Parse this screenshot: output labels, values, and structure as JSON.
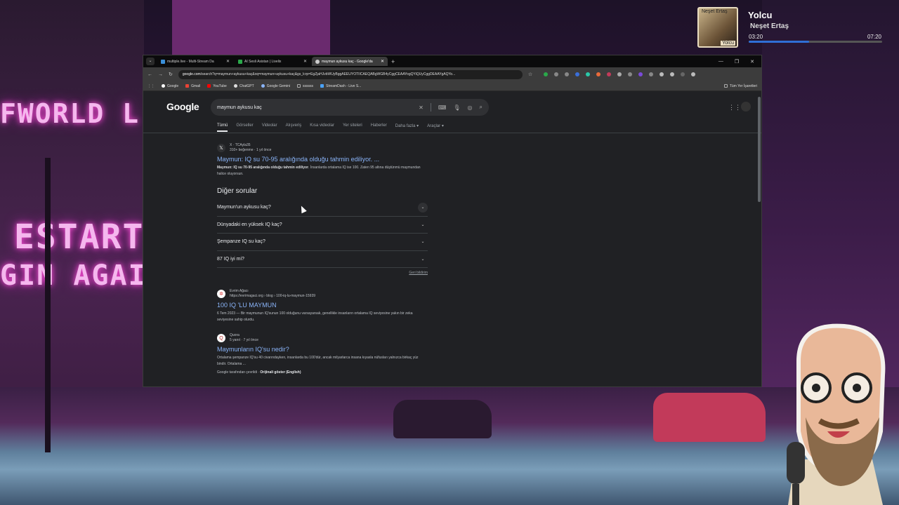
{
  "music": {
    "album_top": "Neşet Ertaş",
    "album_bottom": "Yolcu",
    "title": "Yolcu",
    "artist": "Neşet Ertaş",
    "time_current": "03:20",
    "time_total": "07:20",
    "progress": 0.45
  },
  "background": {
    "neon1": "FWORLD L",
    "neon2": "ESTART",
    "neon3": "GIN AGAIN"
  },
  "browser": {
    "tabs": [
      {
        "label": "multiple.live - Multi-Stream Da",
        "color": "#3a8fd9",
        "active": false
      },
      {
        "label": "AI Sesli Asistan | Livelix",
        "color": "#2aa84a",
        "active": false
      },
      {
        "label": "maymun aykusu kaç - Google'da",
        "color": "#cccccc",
        "active": true
      }
    ],
    "new_tab": "+",
    "window_controls": [
      "—",
      "❐",
      "✕"
    ],
    "url_host": "google.com",
    "url_rest": "/search?q=maymun+aykusu+kaç&oq=maymun+aykusu+kaç&gs_lcrp=EgZjaHJvbWUyBggAEEUYOTIICAEQABgWGB4yCggCEAAYogQYiQUyCggDEAAYgAQYo...",
    "bookmarks": [
      {
        "label": "Google",
        "color": "#ffffff"
      },
      {
        "label": "Gmail",
        "color": "#ea4335"
      },
      {
        "label": "YouTube",
        "color": "#ff0000"
      },
      {
        "label": "ChatGPT",
        "color": "#dddddd"
      },
      {
        "label": "Google Gemini",
        "color": "#8ab4f8"
      },
      {
        "label": "ssssss",
        "color": "#aaaaaa"
      },
      {
        "label": "StreamDash - Live S...",
        "color": "#4aa3ff"
      }
    ],
    "all_bookmarks": "Tüm Yer İşaretleri"
  },
  "google": {
    "logo": "Google",
    "query": "maymun aykusu kaç",
    "search_tabs": [
      "Tümü",
      "Görseller",
      "Videolar",
      "Alışveriş",
      "Kısa videolar",
      "Yer siteleri",
      "Haberler",
      "Daha fazla ▾",
      "Araçlar ▾"
    ],
    "result1": {
      "site": "X · TCAyla35",
      "meta": "310+ beğenme · 1 yıl önce",
      "title": "Maymun: IQ su 70-95 aralığında olduğu tahmin ediliyor. ...",
      "snippet_bold": "Maymun: IQ su 70-95 aralığında olduğu tahmin ediliyor",
      "snippet": ". İnsanlarda ortalama IQ ise 100. Zaten 95 altına düştünmü maymundan halice oluyorsun."
    },
    "paa_title": "Diğer sorular",
    "paa": [
      "Maymun'un aykusu kaç?",
      "Dünyadaki en yüksek IQ kaç?",
      "Şempanze IQ su kaç?",
      "87 IQ iyi mi?"
    ],
    "feedback": "Geri bildirim",
    "result2": {
      "site": "Evrim Ağacı",
      "meta": "https://evrimagaci.org › blog › 100-iq-lu-maymun-15939",
      "title": "100 IQ 'LU MAYMUN",
      "snippet": "6 Tem 2023 — Bir maymunun IQ'sunun 100 olduğunu varsayarsak, genellikle insanların ortalama IQ seviyesine yakın bir zeka seviyesine sahip olurdu."
    },
    "result3": {
      "site": "Quora",
      "meta": "5 yanıt · 7 yıl önce",
      "title": "Maymunların IQ'su nedir?",
      "snippet": "Ortalama şempanze IQ'su 40 civarındayken, insanlarda bu 100'dür, ancak milyarlarca insana kıyasla nüfusları yalnızca birkaç yüz bindir. Ortalama ...",
      "translate_prefix": "Google tarafından çevrildi · ",
      "translate_link": "Orijinali göster (English)"
    }
  }
}
